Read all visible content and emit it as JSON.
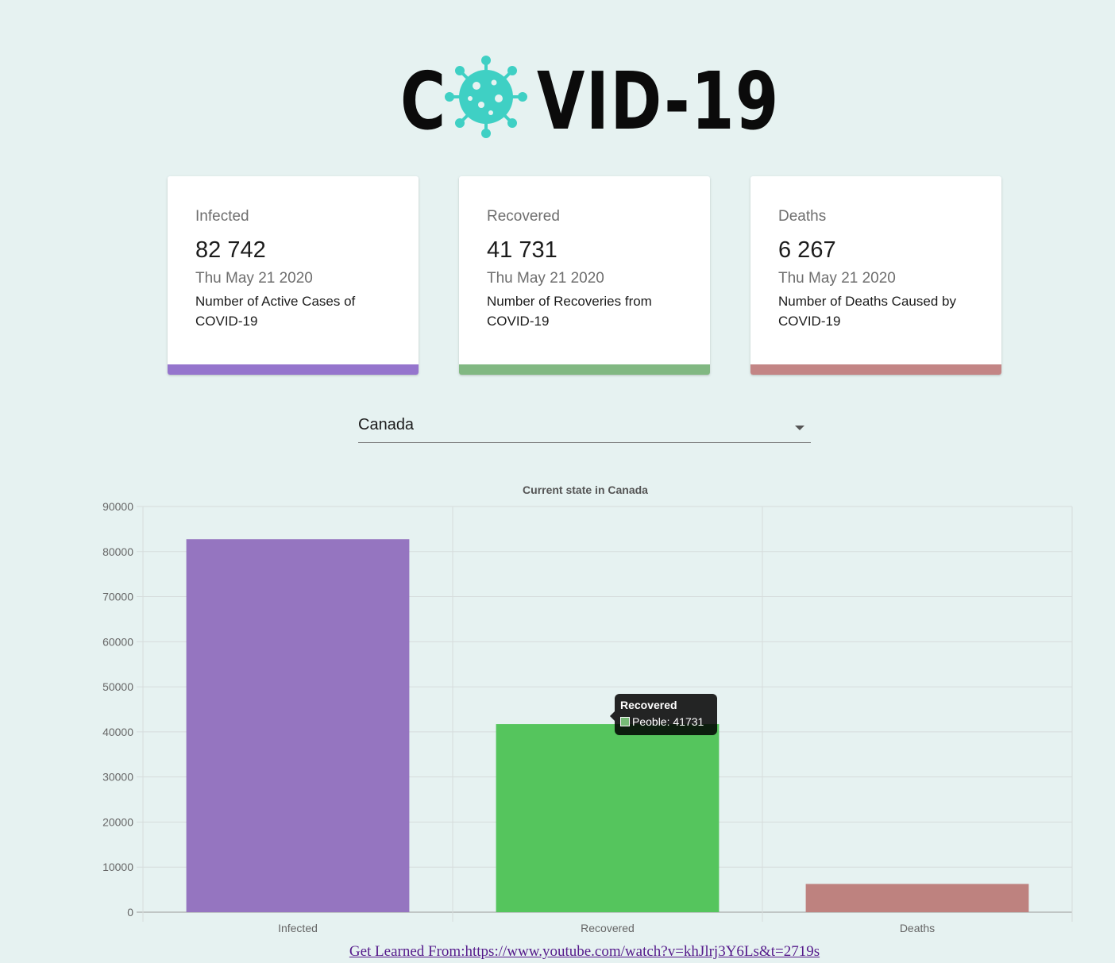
{
  "logo": {
    "text_left": "C",
    "text_right": "VID-19",
    "accent": "#3fd0c4"
  },
  "cards": [
    {
      "title": "Infected",
      "value": "82 742",
      "date": "Thu May 21 2020",
      "description": "Number of Active Cases of COVID-19",
      "color": "#9575cd"
    },
    {
      "title": "Recovered",
      "value": "41 731",
      "date": "Thu May 21 2020",
      "description": "Number of Recoveries from COVID-19",
      "color": "#81b882"
    },
    {
      "title": "Deaths",
      "value": "6 267",
      "date": "Thu May 21 2020",
      "description": "Number of Deaths Caused by COVID-19",
      "color": "#c38585"
    }
  ],
  "country_select": {
    "value": "Canada"
  },
  "chart_data": {
    "type": "bar",
    "title": "Current state in Canada",
    "categories": [
      "Infected",
      "Recovered",
      "Deaths"
    ],
    "series": [
      {
        "values": [
          82742,
          41731,
          6267
        ]
      }
    ],
    "colors": [
      "#9575c0",
      "#55c55d",
      "#be827f"
    ],
    "y_ticks": [
      0,
      10000,
      20000,
      30000,
      40000,
      50000,
      60000,
      70000,
      80000,
      90000
    ],
    "ylim": [
      0,
      90000
    ],
    "grid": true
  },
  "tooltip": {
    "title": "Recovered",
    "label": "Peoble: 41731"
  },
  "footer": {
    "link_text": "Get Learned From:https://www.youtube.com/watch?v=khJlrj3Y6Ls&t=2719s"
  }
}
